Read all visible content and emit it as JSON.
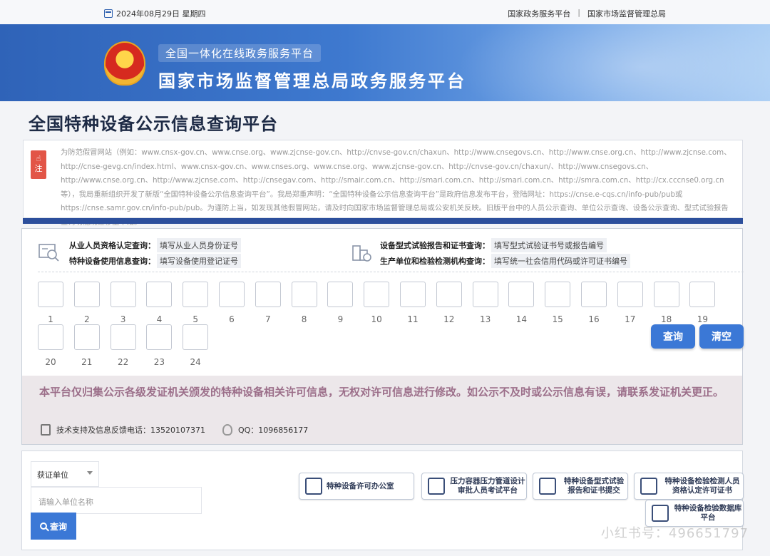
{
  "topbar": {
    "date": "2024年08月29日 星期四",
    "link1": "国家政务服务平台",
    "separator": "|",
    "link2": "国家市场监督管理总局"
  },
  "banner": {
    "subtitle": "全国一体化在线政务服务平台",
    "title": "国家市场监督管理总局政务服务平台"
  },
  "page_title": "全国特种设备公示信息查询平台",
  "notice": {
    "tag": "注",
    "text": "为防范假冒网站（例如：www.cnsx-gov.cn、www.cnse.org、www.zjcnse-gov.cn、http://cnvse-gov.cn/chaxun、http://www.cnsegovs.cn、http://www.cnse.org.cn、http://www.zjcnse.com、http://cnse-gevg.cn/index.html、www.cnsx-gov.cn、www.cnses.org、www.cnse.org、www.zjcnse-gov.cn、http://cnvse-gov.cn/chaxun/、http://www.cnsegovs.cn、http://www.cnse.org.cn、http://www.zjcnse.com、http://cnsegav.com、http://smair.com.cn、http://smari.com.cn、http://smari.com.cn、http://smra.com.cn、http://cx.cccnse0.org.cn 等），我局重新组织开发了新版“全国特种设备公示信息查询平台”。我局郑重声明：“全国特种设备公示信息查询平台”是政府信息发布平台，登陆网址：https://cnse.e-cqs.cn/info-pub/pub或https://cnse.samr.gov.cn/info-pub/pub。为谨防上当，如发现其他假冒网站，请及时向国家市场监督管理总局或公安机关反映。旧版平台中的人员公示查询、单位公示查询、设备公示查询、型式试验报告查询功能现迁移至本站。"
  },
  "query": {
    "row1_label": "从业人员资格认定查询：",
    "row1_hint": "填写从业人员身份证号",
    "row2_label": "特种设备使用信息查询：",
    "row2_hint": "填写设备使用登记证号",
    "row3_label": "设备型式试验报告和证书查询：",
    "row3_hint": "填写型式试验证书号或报告编号",
    "row4_label": "生产单位和检验检测机构查询：",
    "row4_hint": "填写统一社会信用代码或许可证书编号",
    "box_numbers": [
      "1",
      "2",
      "3",
      "4",
      "5",
      "6",
      "7",
      "8",
      "9",
      "10",
      "11",
      "12",
      "13",
      "14",
      "15",
      "16",
      "17",
      "18",
      "19",
      "20",
      "21",
      "22",
      "23",
      "24"
    ],
    "search_label": "查询",
    "clear_label": "清空"
  },
  "disclaimer": {
    "message": "本平台仅归集公示各级发证机关颁发的特种设备相关许可信息，无权对许可信息进行修改。如公示不及时或公示信息有误，请联系发证机关更正。",
    "phone_label": "技术支持及信息反馈电话：13520107371",
    "qq_label": "QQ：1096856177"
  },
  "bottom": {
    "select_value": "获证单位",
    "input_placeholder": "请输入单位名称",
    "search_label": "查询",
    "links": [
      "特种设备许可办公室",
      "压力容器压力管道设计审批人员考试平台",
      "特种设备型式试验报告和证书提交",
      "特种设备检验检测人员资格认定许可证书",
      "特种设备检验数据库平台"
    ]
  },
  "watermark": "小红书号：496651797"
}
